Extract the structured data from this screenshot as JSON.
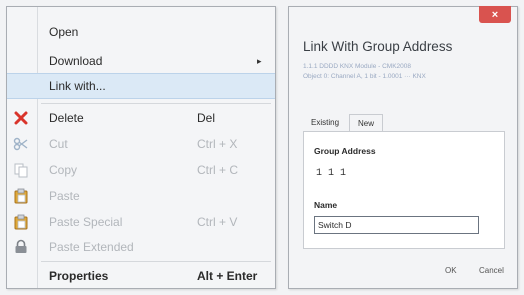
{
  "context_menu": {
    "items": [
      {
        "label": "Open",
        "shortcut": "",
        "icon": "",
        "disabled": false
      },
      {
        "label": "Download",
        "shortcut": "",
        "icon": "",
        "disabled": false,
        "submenu_arrow": "▸"
      },
      {
        "label": "Link with...",
        "shortcut": "",
        "icon": "",
        "disabled": false
      },
      {
        "label": "Delete",
        "shortcut": "Del",
        "icon": "delete-x-icon",
        "disabled": false
      },
      {
        "label": "Cut",
        "shortcut": "Ctrl + X",
        "icon": "scissors-icon",
        "disabled": true
      },
      {
        "label": "Copy",
        "shortcut": "Ctrl + C",
        "icon": "copy-icon",
        "disabled": true
      },
      {
        "label": "Paste",
        "shortcut": "",
        "icon": "clipboard-icon",
        "disabled": true
      },
      {
        "label": "Paste Special",
        "shortcut": "Ctrl + V",
        "icon": "clipboard-icon",
        "disabled": true
      },
      {
        "label": "Paste Extended",
        "shortcut": "",
        "icon": "lock-icon",
        "disabled": true
      },
      {
        "label": "Properties",
        "shortcut": "Alt + Enter",
        "icon": "",
        "disabled": false
      }
    ]
  },
  "dialog": {
    "close_label": "×",
    "title": "Link With Group Address",
    "subtitle_line1": "1.1.1 DDDD KNX Module - CMK2008",
    "subtitle_line2": "Object 0: Channel A, 1 bit - 1.0001 ··· KNX",
    "tabs": [
      "Existing",
      "New"
    ],
    "group_address_label": "Group Address",
    "group_address_value": "1 1 1",
    "name_label": "Name",
    "name_value": "Switch D",
    "ok_label": "OK",
    "cancel_label": "Cancel"
  },
  "colors": {
    "delete_red": "#d9342b",
    "highlight": "#dbe9f6",
    "close_red": "#d9534f"
  }
}
